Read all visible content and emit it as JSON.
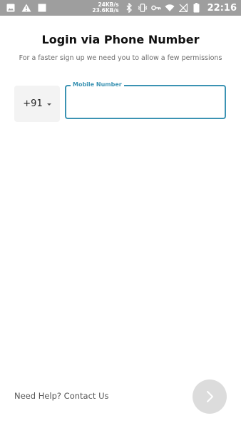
{
  "status_bar": {
    "net_speed_up": "24KB/s",
    "net_speed_down": "23.6KB/s",
    "time": "22:16",
    "icons": [
      "image-icon",
      "warning-icon",
      "square-icon",
      "bluetooth-icon",
      "vibrate-icon",
      "key-icon",
      "wifi-icon",
      "no-signal-icon",
      "battery-icon"
    ]
  },
  "header": {
    "title": "Login via Phone Number",
    "subtitle": "For a faster sign up we need you to allow a few permissions"
  },
  "form": {
    "country_code": "+91",
    "mobile_label": "Mobile Number",
    "mobile_value": "",
    "mobile_placeholder": ""
  },
  "footer": {
    "help_text": "Need Help? Contact Us",
    "next_icon": "chevron-right-icon"
  },
  "colors": {
    "accent": "#3b93b3",
    "status_bar": "#9e9e9e",
    "next_button_bg": "#dcdcdc"
  }
}
